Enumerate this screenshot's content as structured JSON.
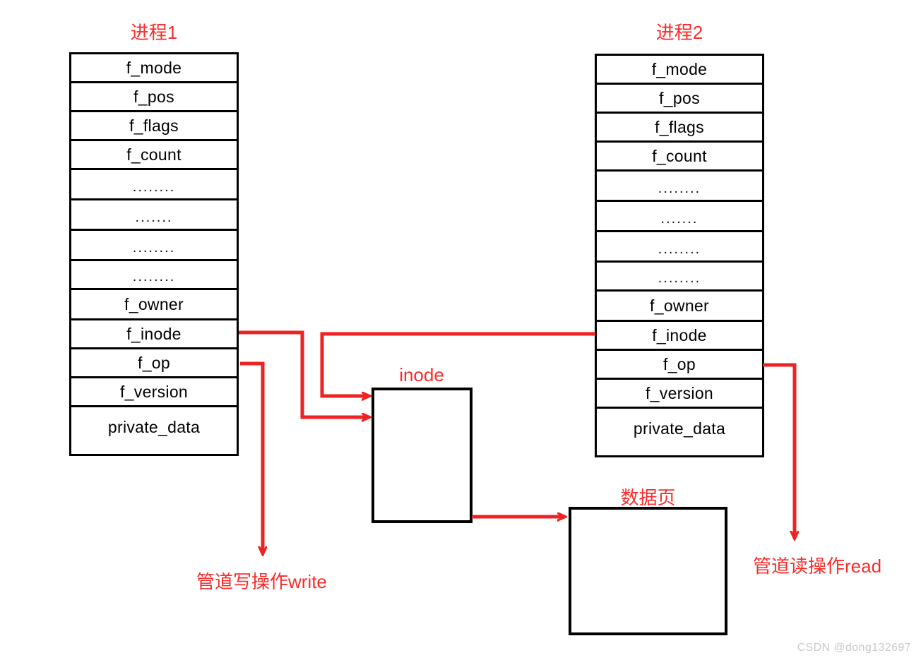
{
  "diagram": {
    "title_process1": "进程1",
    "title_process2": "进程2",
    "inode_label": "inode",
    "datapage_label": "数据页",
    "write_label": "管道写操作write",
    "read_label": "管道读操作read",
    "accent_color": "#fa2a2a",
    "line_color": "#000000"
  },
  "process1": {
    "caption": "进程1",
    "fields": [
      {
        "label": "f_mode",
        "kind": "text"
      },
      {
        "label": "f_pos",
        "kind": "text"
      },
      {
        "label": "f_flags",
        "kind": "text"
      },
      {
        "label": "f_count",
        "kind": "text"
      },
      {
        "label": "........",
        "kind": "dots"
      },
      {
        "label": ".......",
        "kind": "dots"
      },
      {
        "label": "........",
        "kind": "dots"
      },
      {
        "label": "........",
        "kind": "dots"
      },
      {
        "label": "f_owner",
        "kind": "text"
      },
      {
        "label": "f_inode",
        "kind": "text"
      },
      {
        "label": "f_op",
        "kind": "text"
      },
      {
        "label": "f_version",
        "kind": "text"
      },
      {
        "label": "private_data",
        "kind": "text"
      }
    ]
  },
  "process2": {
    "caption": "进程2",
    "fields": [
      {
        "label": "f_mode",
        "kind": "text"
      },
      {
        "label": "f_pos",
        "kind": "text"
      },
      {
        "label": "f_flags",
        "kind": "text"
      },
      {
        "label": "f_count",
        "kind": "text"
      },
      {
        "label": "........",
        "kind": "dots"
      },
      {
        "label": ".......",
        "kind": "dots"
      },
      {
        "label": "........",
        "kind": "dots"
      },
      {
        "label": "........",
        "kind": "dots"
      },
      {
        "label": "f_owner",
        "kind": "text"
      },
      {
        "label": "f_inode",
        "kind": "text"
      },
      {
        "label": "f_op",
        "kind": "text"
      },
      {
        "label": "f_version",
        "kind": "text"
      },
      {
        "label": "private_data",
        "kind": "text"
      }
    ]
  },
  "inode_box": {
    "label": "inode",
    "content": ""
  },
  "data_page_box": {
    "label": "数据页",
    "content": ""
  },
  "annotations": {
    "write": "管道写操作write",
    "read": "管道读操作read"
  },
  "watermark": "CSDN @dong132697"
}
